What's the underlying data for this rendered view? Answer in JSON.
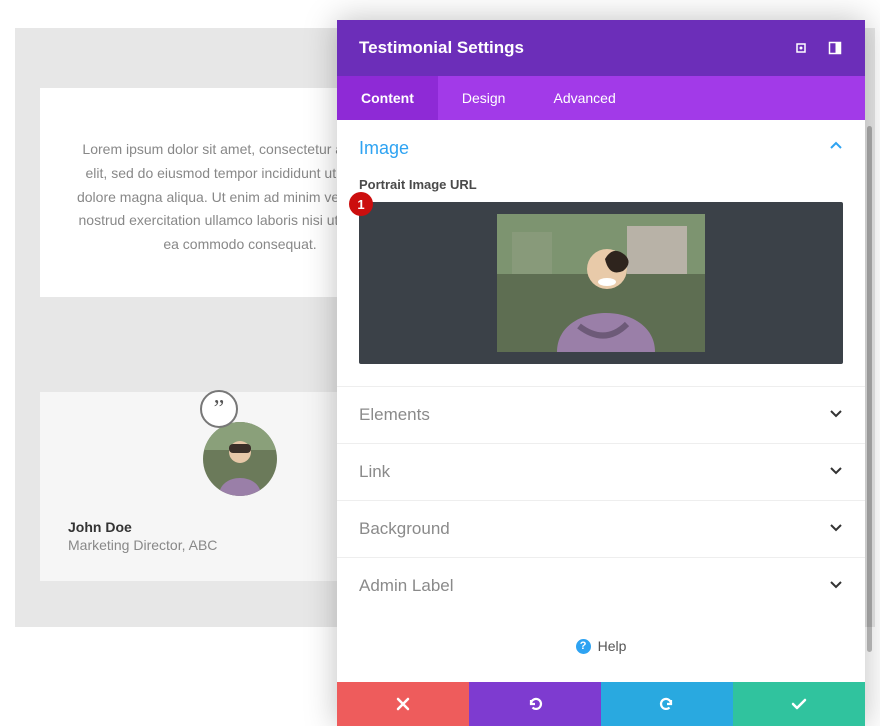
{
  "page": {
    "testimonial_text": "Lorem ipsum dolor sit amet, consectetur adipiscing elit, sed do eiusmod tempor incididunt ut labore et dolore magna aliqua. Ut enim ad minim veniam, quis nostrud exercitation ullamco laboris nisi ut aliquip ex ea commodo consequat.",
    "author_name": "John Doe",
    "author_role": "Marketing Director, ABC",
    "quote_glyph": "”"
  },
  "panel": {
    "title": "Testimonial Settings",
    "tabs": {
      "content": "Content",
      "design": "Design",
      "advanced": "Advanced"
    },
    "image_section": {
      "title": "Image",
      "field_label": "Portrait Image URL",
      "marker": "1"
    },
    "sections": {
      "elements": "Elements",
      "link": "Link",
      "background": "Background",
      "admin_label": "Admin Label"
    },
    "help_label": "Help",
    "help_icon": "?"
  }
}
